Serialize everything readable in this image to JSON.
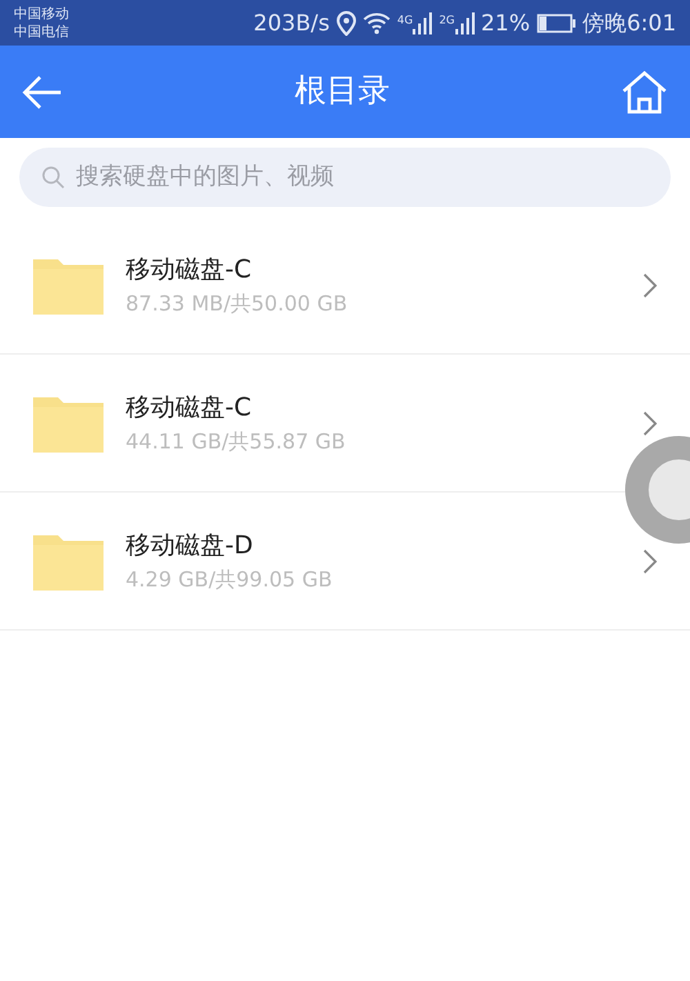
{
  "status_bar": {
    "carriers": [
      "中国移动",
      "中国电信"
    ],
    "speed": "203B/s",
    "net1": "4G",
    "net2": "2G",
    "battery_text": "21%",
    "time": "傍晚6:01"
  },
  "header": {
    "title": "根目录"
  },
  "search": {
    "placeholder": "搜索硬盘中的图片、视频"
  },
  "drives": [
    {
      "name": "移动磁盘-C",
      "usage": "87.33 MB/共50.00 GB"
    },
    {
      "name": "移动磁盘-C",
      "usage": "44.11 GB/共55.87 GB"
    },
    {
      "name": "移动磁盘-D",
      "usage": "4.29 GB/共99.05 GB"
    }
  ]
}
